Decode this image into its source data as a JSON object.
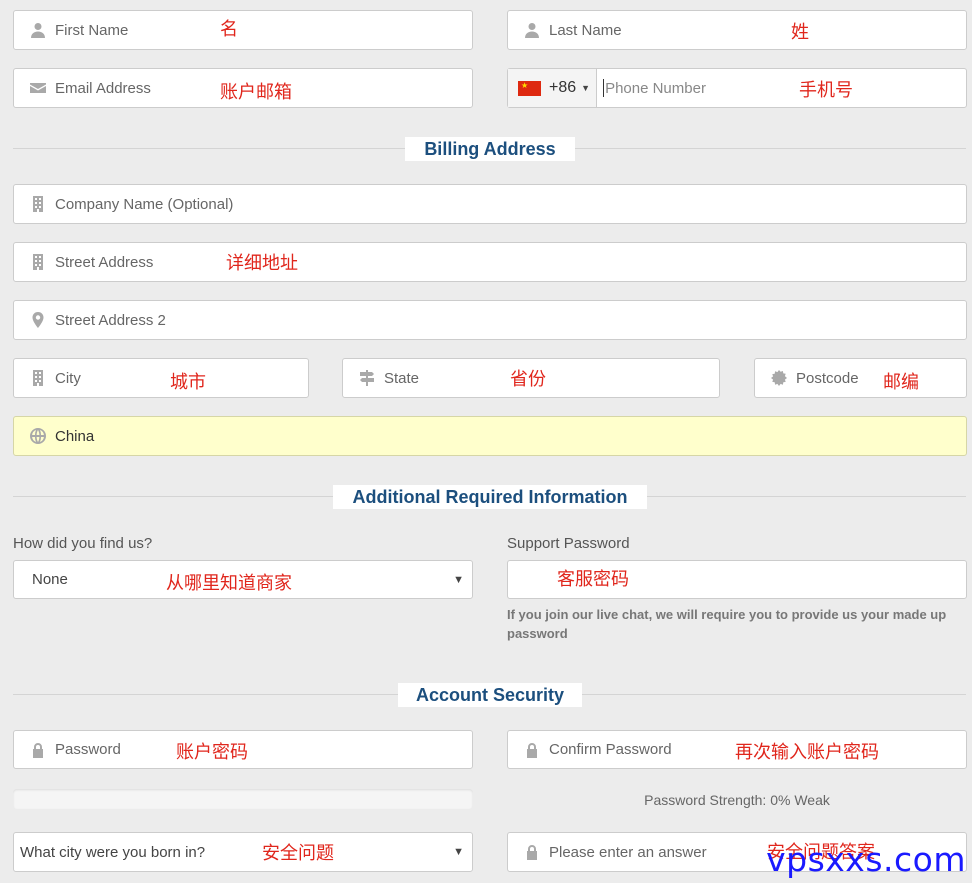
{
  "personal": {
    "first_name": {
      "placeholder": "First Name",
      "annotation": "名"
    },
    "last_name": {
      "placeholder": "Last Name",
      "annotation": "姓"
    },
    "email": {
      "placeholder": "Email Address",
      "annotation": "账户邮箱"
    },
    "phone": {
      "country_code": "+86",
      "placeholder": "Phone Number",
      "annotation": "手机号"
    }
  },
  "billing": {
    "title": "Billing Address",
    "company": {
      "placeholder": "Company Name (Optional)"
    },
    "street": {
      "placeholder": "Street Address",
      "annotation": "详细地址"
    },
    "street2": {
      "placeholder": "Street Address 2"
    },
    "city": {
      "placeholder": "City",
      "annotation": "城市"
    },
    "state": {
      "placeholder": "State",
      "annotation": "省份"
    },
    "postcode": {
      "placeholder": "Postcode",
      "annotation": "邮编"
    },
    "country": {
      "value": "China"
    }
  },
  "additional": {
    "title": "Additional Required Information",
    "find_us": {
      "label": "How did you find us?",
      "value": "None",
      "annotation": "从哪里知道商家"
    },
    "support_password": {
      "label": "Support Password",
      "annotation": "客服密码",
      "help": "If you join our live chat, we will require you to provide us your made up password"
    }
  },
  "security": {
    "title": "Account Security",
    "password": {
      "placeholder": "Password",
      "annotation": "账户密码"
    },
    "confirm_password": {
      "placeholder": "Confirm Password",
      "annotation": "再次输入账户密码"
    },
    "strength_text": "Password Strength: 0% Weak",
    "strength_percent": 0,
    "question": {
      "value": "What city were you born in?",
      "annotation": "安全问题"
    },
    "answer": {
      "placeholder": "Please enter an answer",
      "annotation": "安全问题答案"
    }
  },
  "watermark": "vpsxxs.com",
  "colors": {
    "accent": "#1c4f7e",
    "annotation": "#e0261c",
    "country_bg": "#ffffcc",
    "watermark": "#1a1aff"
  }
}
